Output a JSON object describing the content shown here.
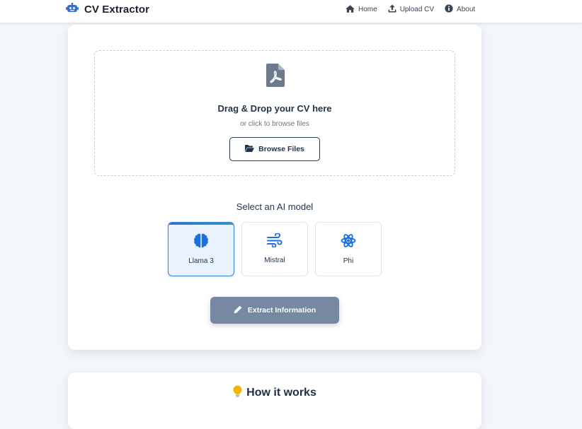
{
  "header": {
    "brand": "CV Extractor",
    "nav": [
      {
        "label": "Home",
        "icon": "home-icon"
      },
      {
        "label": "Upload CV",
        "icon": "upload-icon"
      },
      {
        "label": "About",
        "icon": "info-icon"
      }
    ]
  },
  "upload": {
    "title": "Drag & Drop your CV here",
    "subtitle": "or click to browse files",
    "browse_label": "Browse Files"
  },
  "models": {
    "heading": "Select an AI model",
    "selected": "Llama 3",
    "items": [
      {
        "label": "Llama 3",
        "icon": "brain-icon"
      },
      {
        "label": "Mistral",
        "icon": "wind-icon"
      },
      {
        "label": "Phi",
        "icon": "atom-icon"
      }
    ]
  },
  "actions": {
    "extract_label": "Extract Information"
  },
  "how_it_works": {
    "title": "How it works"
  },
  "colors": {
    "accent": "#2f6fd2",
    "selected_bg": "#e9f3fe",
    "extract_btn": "#7788a3",
    "page_bg": "#f3f6fa",
    "bulb": "#f5b400"
  }
}
